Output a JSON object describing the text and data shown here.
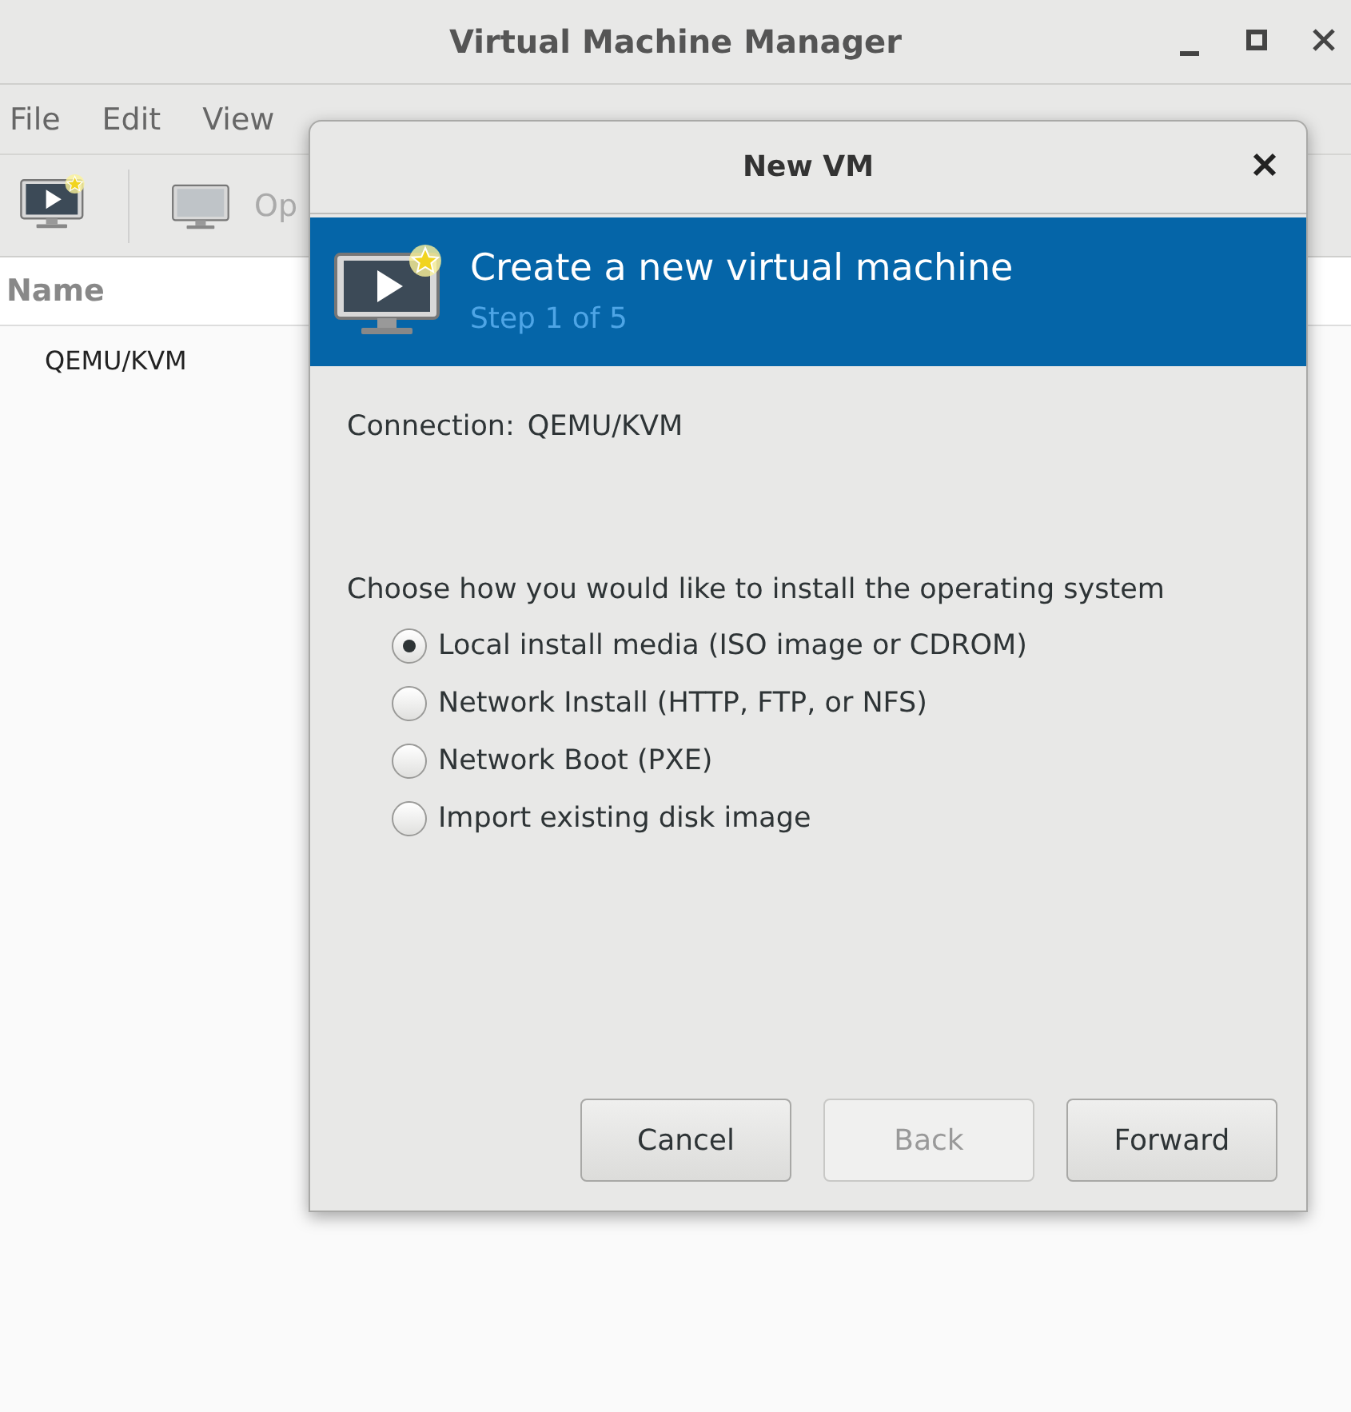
{
  "window": {
    "title": "Virtual Machine Manager"
  },
  "menu": [
    "File",
    "Edit",
    "View"
  ],
  "toolbar": {
    "open_label": "Op"
  },
  "list": {
    "column": "Name",
    "rows": [
      "QEMU/KVM"
    ]
  },
  "dialog": {
    "title": "New VM",
    "header": {
      "title": "Create a new virtual machine",
      "step": "Step 1 of 5"
    },
    "connection": {
      "label": "Connection:",
      "value": "QEMU/KVM"
    },
    "prompt": "Choose how you would like to install the operating system",
    "options": [
      {
        "label": "Local install media (ISO image or CDROM)",
        "selected": true
      },
      {
        "label": "Network Install (HTTP, FTP, or NFS)",
        "selected": false
      },
      {
        "label": "Network Boot (PXE)",
        "selected": false
      },
      {
        "label": "Import existing disk image",
        "selected": false
      }
    ],
    "buttons": [
      {
        "label": "Cancel",
        "disabled": false
      },
      {
        "label": "Back",
        "disabled": true
      },
      {
        "label": "Forward",
        "disabled": false
      }
    ]
  }
}
